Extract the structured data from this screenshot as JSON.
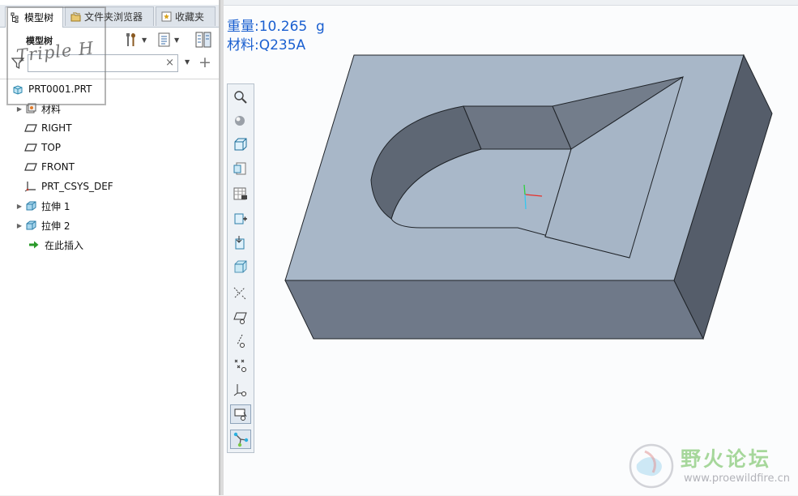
{
  "tabs": [
    {
      "label": "模型树",
      "icon": "model-tree-icon",
      "active": true
    },
    {
      "label": "文件夹浏览器",
      "icon": "folder-browser-icon",
      "active": false
    },
    {
      "label": "收藏夹",
      "icon": "favorites-icon",
      "active": false
    }
  ],
  "toolbar": {
    "title": "模型树"
  },
  "watermark": {
    "text": "Triple H"
  },
  "search": {
    "value": "",
    "clear_glyph": "×"
  },
  "tree": {
    "root": "PRT0001.PRT",
    "items": [
      {
        "label": "材料",
        "icon": "material-icon",
        "expandable": true
      },
      {
        "label": "RIGHT",
        "icon": "datum-plane-icon",
        "expandable": false
      },
      {
        "label": "TOP",
        "icon": "datum-plane-icon",
        "expandable": false
      },
      {
        "label": "FRONT",
        "icon": "datum-plane-icon",
        "expandable": false
      },
      {
        "label": "PRT_CSYS_DEF",
        "icon": "csys-icon",
        "expandable": false
      },
      {
        "label": "拉伸 1",
        "icon": "extrude-icon",
        "expandable": true
      },
      {
        "label": "拉伸 2",
        "icon": "extrude-icon",
        "expandable": true
      },
      {
        "label": "在此插入",
        "icon": "insert-here-icon",
        "expandable": false
      }
    ]
  },
  "mass_properties": {
    "weight": "重量:10.265  g",
    "material": "材料:Q235A"
  },
  "view_toolbar": [
    "zoom-icon",
    "display-style-icon",
    "saved-orientations-icon",
    "view-manager-icon",
    "appearance-gallery-icon",
    "add-component-icon",
    "section-icon",
    "transparency-icon",
    "datum-display-icon",
    "plane-display-icon",
    "axis-display-icon",
    "point-display-icon",
    "csys-display-icon",
    "annotation-display-icon",
    "spin-center-icon"
  ],
  "forum": {
    "name": "野火论坛",
    "url": "www.proewildfire.cn"
  },
  "colors": {
    "accent": "#1a5fd0",
    "top_face": "#a9b8c9",
    "side_face": "#6e7887",
    "dark_face": "#545c68"
  }
}
